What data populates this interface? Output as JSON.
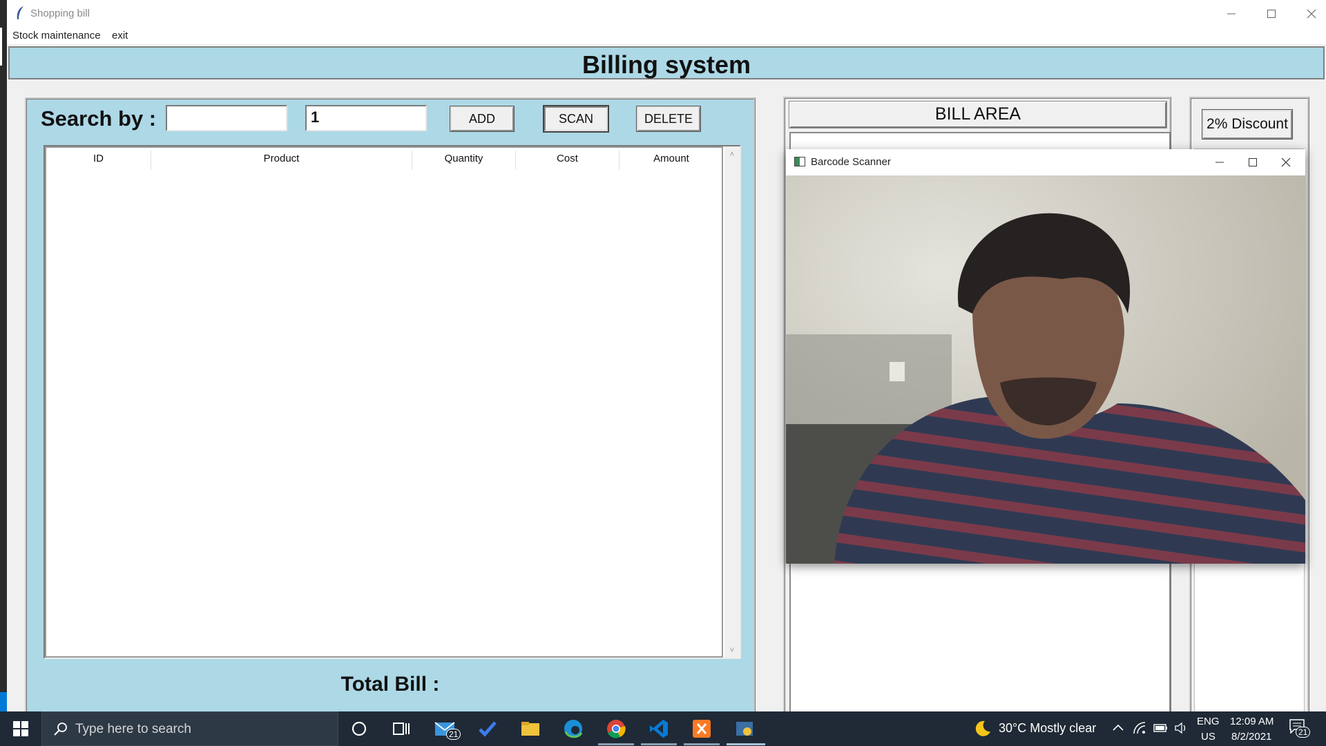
{
  "window": {
    "title": "Shopping bill",
    "menu": [
      "Stock maintenance",
      "exit"
    ]
  },
  "header": {
    "title": "Billing system"
  },
  "search": {
    "label": "Search by :",
    "query_value": "",
    "quantity_value": "1",
    "buttons": {
      "add": "ADD",
      "scan": "SCAN",
      "delete": "DELETE"
    }
  },
  "table": {
    "columns": [
      "ID",
      "Product",
      "Quantity",
      "Cost",
      "Amount"
    ],
    "rows": []
  },
  "total": {
    "label": "Total Bill :"
  },
  "bill": {
    "label": "BILL AREA"
  },
  "discount": {
    "button": "2% Discount"
  },
  "scanner": {
    "title": "Barcode Scanner"
  },
  "taskbar": {
    "search_placeholder": "Type here to search",
    "mail_badge": "21",
    "weather": "30°C  Mostly clear",
    "lang_top": "ENG",
    "lang_bottom": "US",
    "time": "12:09 AM",
    "date": "8/2/2021",
    "notification_count": "21"
  }
}
